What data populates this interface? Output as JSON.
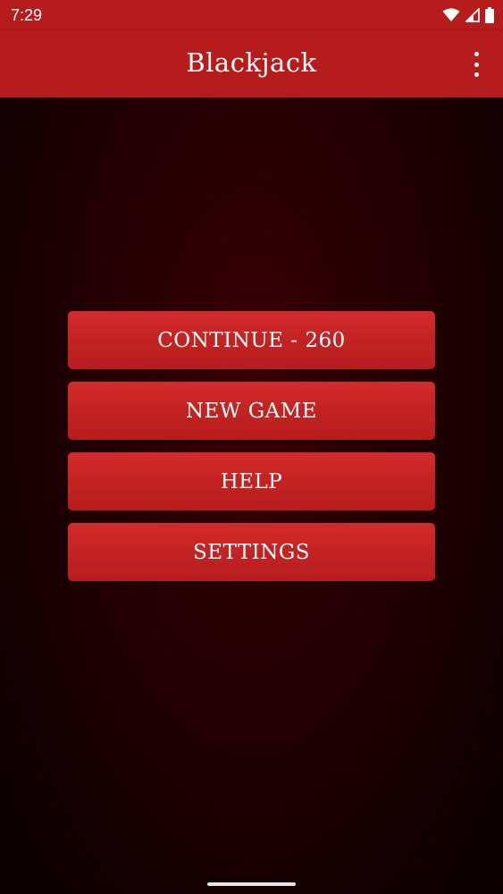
{
  "status_bar": {
    "time": "7:29",
    "icons": [
      "wifi-icon",
      "cell-signal-icon",
      "battery-icon"
    ]
  },
  "app_bar": {
    "title": "Blackjack",
    "overflow_icon": "more-vert-icon"
  },
  "menu": {
    "continue_label": "CONTINUE - 260",
    "new_game_label": "NEW GAME",
    "help_label": "HELP",
    "settings_label": "SETTINGS"
  },
  "colors": {
    "primary": "#b71c1c",
    "button": "#c62828",
    "background": "#1a0000"
  }
}
